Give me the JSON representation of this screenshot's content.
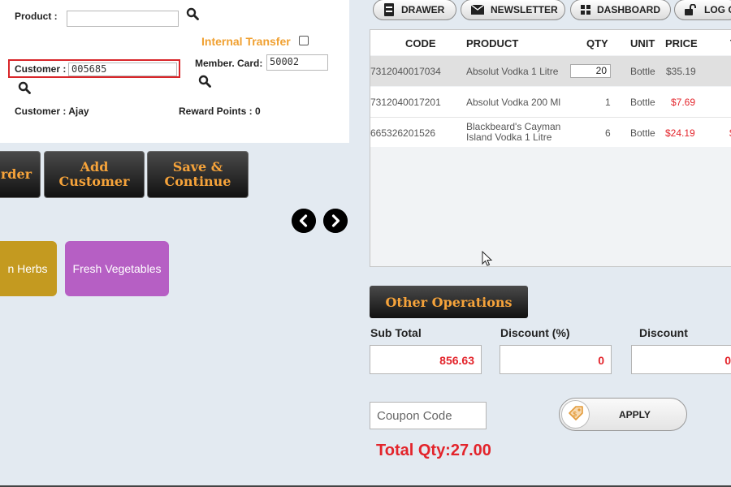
{
  "form": {
    "product_label": "Product :",
    "product_value": "",
    "internal_transfer_label": "Internal Transfer",
    "internal_transfer_checked": false,
    "customer_label": "Customer :",
    "customer_value": "005685",
    "member_card_label": "Member. Card:",
    "member_card_value": "50002",
    "customer_name": "Customer : Ajay",
    "reward_points": "Reward Points : 0"
  },
  "actions": {
    "order_label": "rder",
    "add_customer_label": "Add Customer",
    "save_continue_label": "Save & Continue"
  },
  "categories": [
    {
      "label": "n Herbs",
      "color": "#c49a20"
    },
    {
      "label": "Fresh Vegetables",
      "color": "#b65fc4"
    }
  ],
  "topnav": {
    "drawer": "DRAWER",
    "newsletter": "NEWSLETTER",
    "dashboard": "DASHBOARD",
    "logout": "LOG O"
  },
  "table": {
    "headers": {
      "code": "CODE",
      "product": "PRODUCT",
      "qty": "QTY",
      "unit": "UNIT",
      "price": "PRICE",
      "total": "T"
    },
    "rows": [
      {
        "code": "7312040017034",
        "product": "Absolut Vodka 1 Litre",
        "qty": "20",
        "unit": "Bottle",
        "price": "$35.19",
        "total": ""
      },
      {
        "code": "7312040017201",
        "product": "Absolut Vodka 200 Ml",
        "qty": "1",
        "unit": "Bottle",
        "price": "$7.69",
        "total": ""
      },
      {
        "code": "665326201526",
        "product": "Blackbeard's Cayman Island Vodka 1 Litre",
        "qty": "6",
        "unit": "Bottle",
        "price": "$24.19",
        "total": "$"
      }
    ]
  },
  "other_ops_label": "Other Operations",
  "totals": {
    "subtotal_label": "Sub Total",
    "subtotal_value": "856.63",
    "discount_pct_label": "Discount (%)",
    "discount_pct_value": "0",
    "discount_label": "Discount",
    "discount_value": "0"
  },
  "coupon": {
    "placeholder": "Coupon Code",
    "apply_label": "APPLY"
  },
  "total_qty": "Total Qty:27.00",
  "colors": {
    "accent_orange": "#f6a33a",
    "alert_red": "#e3242b"
  }
}
